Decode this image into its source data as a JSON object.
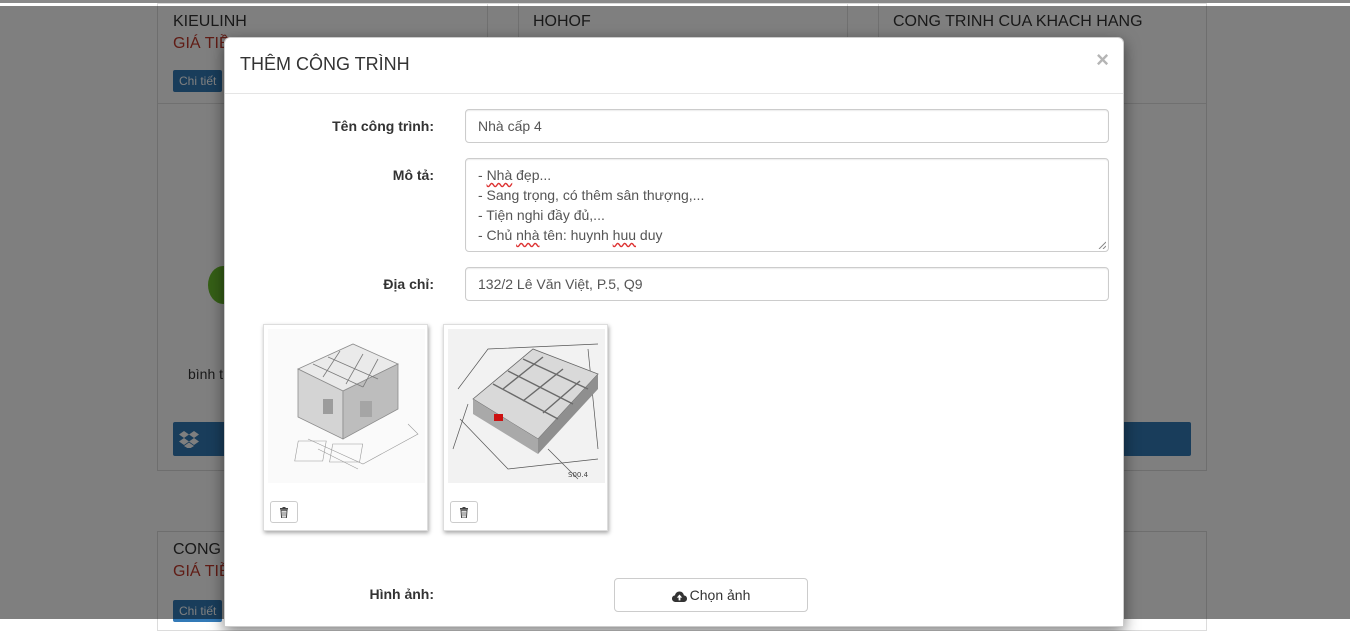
{
  "background": {
    "projects_row1": [
      {
        "title": "KIEULINH",
        "price": "GIÁ TIỀ",
        "detail_label": "Chi tiết"
      },
      {
        "title": "HOHOF"
      },
      {
        "title": "CONG TRINH CUA KHACH HANG"
      }
    ],
    "projects_row2": [
      {
        "title": "CONG",
        "price": "GIÁ TIỀ",
        "detail_label": "Chi tiết"
      }
    ],
    "snippet_text": "bình t"
  },
  "modal": {
    "title": "THÊM CÔNG TRÌNH",
    "close_glyph": "×",
    "fields": {
      "name": {
        "label": "Tên công trình:",
        "value": "Nhà cấp 4"
      },
      "description": {
        "label": "Mô tả:",
        "lines": [
          {
            "pre": "- ",
            "spell": "Nhà",
            "post": " đẹp..."
          },
          {
            "pre": "- Sang trọng, có thêm sân thượng,...",
            "spell": "",
            "post": ""
          },
          {
            "pre": "- Tiện nghi đầy đủ,...",
            "spell": "",
            "post": ""
          },
          {
            "pre": "- Chủ ",
            "spell": "nhà",
            "post": " tên: huynh ",
            "spell2": "huu",
            "post2": " duy"
          }
        ]
      },
      "address": {
        "label": "Địa chỉ:",
        "value": "132/2 Lê Văn Việt, P.5, Q9"
      }
    },
    "images": [
      {
        "alt": "3D house floor plan render 1",
        "icon": "trash-icon"
      },
      {
        "alt": "3D house floor plan render 2",
        "icon": "trash-icon"
      }
    ],
    "image_field_label": "Hình ảnh:",
    "choose_button_label": "Chọn ảnh",
    "choose_button_icon": "cloud-upload-icon"
  },
  "colors": {
    "accent": "#337ab7",
    "price": "#c0392b",
    "backdrop": "rgba(0,0,0,0.5)"
  }
}
